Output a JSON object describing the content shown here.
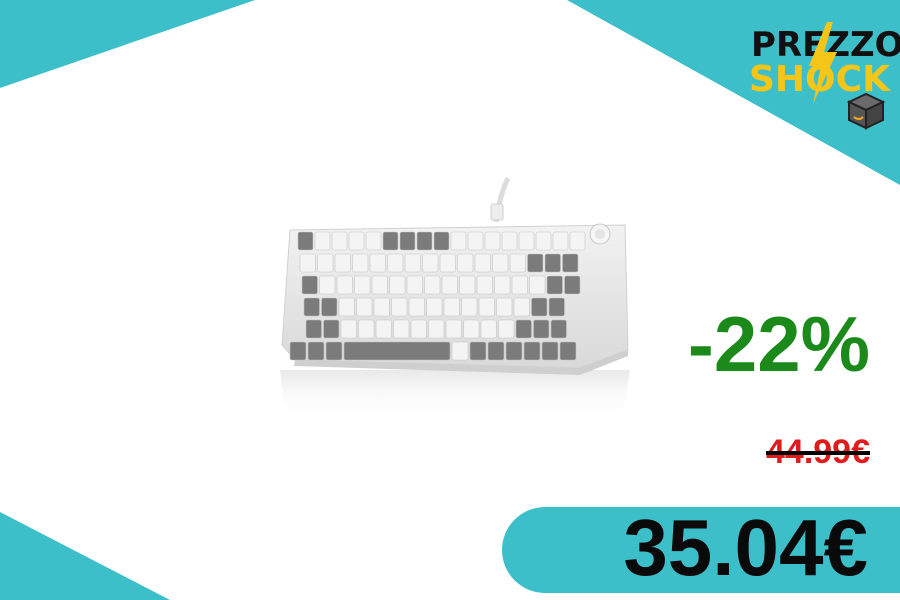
{
  "brand": {
    "line1": "PREZZO",
    "line2": "SHOCK",
    "accent_color": "#f5c518",
    "icons": [
      "lightning-bolt-icon",
      "package-box-icon"
    ]
  },
  "product": {
    "image_description": "keyboard-image",
    "keycap_colors": {
      "light": "#f4f4f4",
      "dark": "#7b7b7b",
      "case": "#e9e9e9"
    }
  },
  "deal": {
    "discount": "-22%",
    "old_price": "44.99€",
    "new_price": "35.04€"
  },
  "colors": {
    "teal": "#3dbfca",
    "discount_green": "#1b8a1b",
    "old_price_red": "#e01b1b"
  }
}
